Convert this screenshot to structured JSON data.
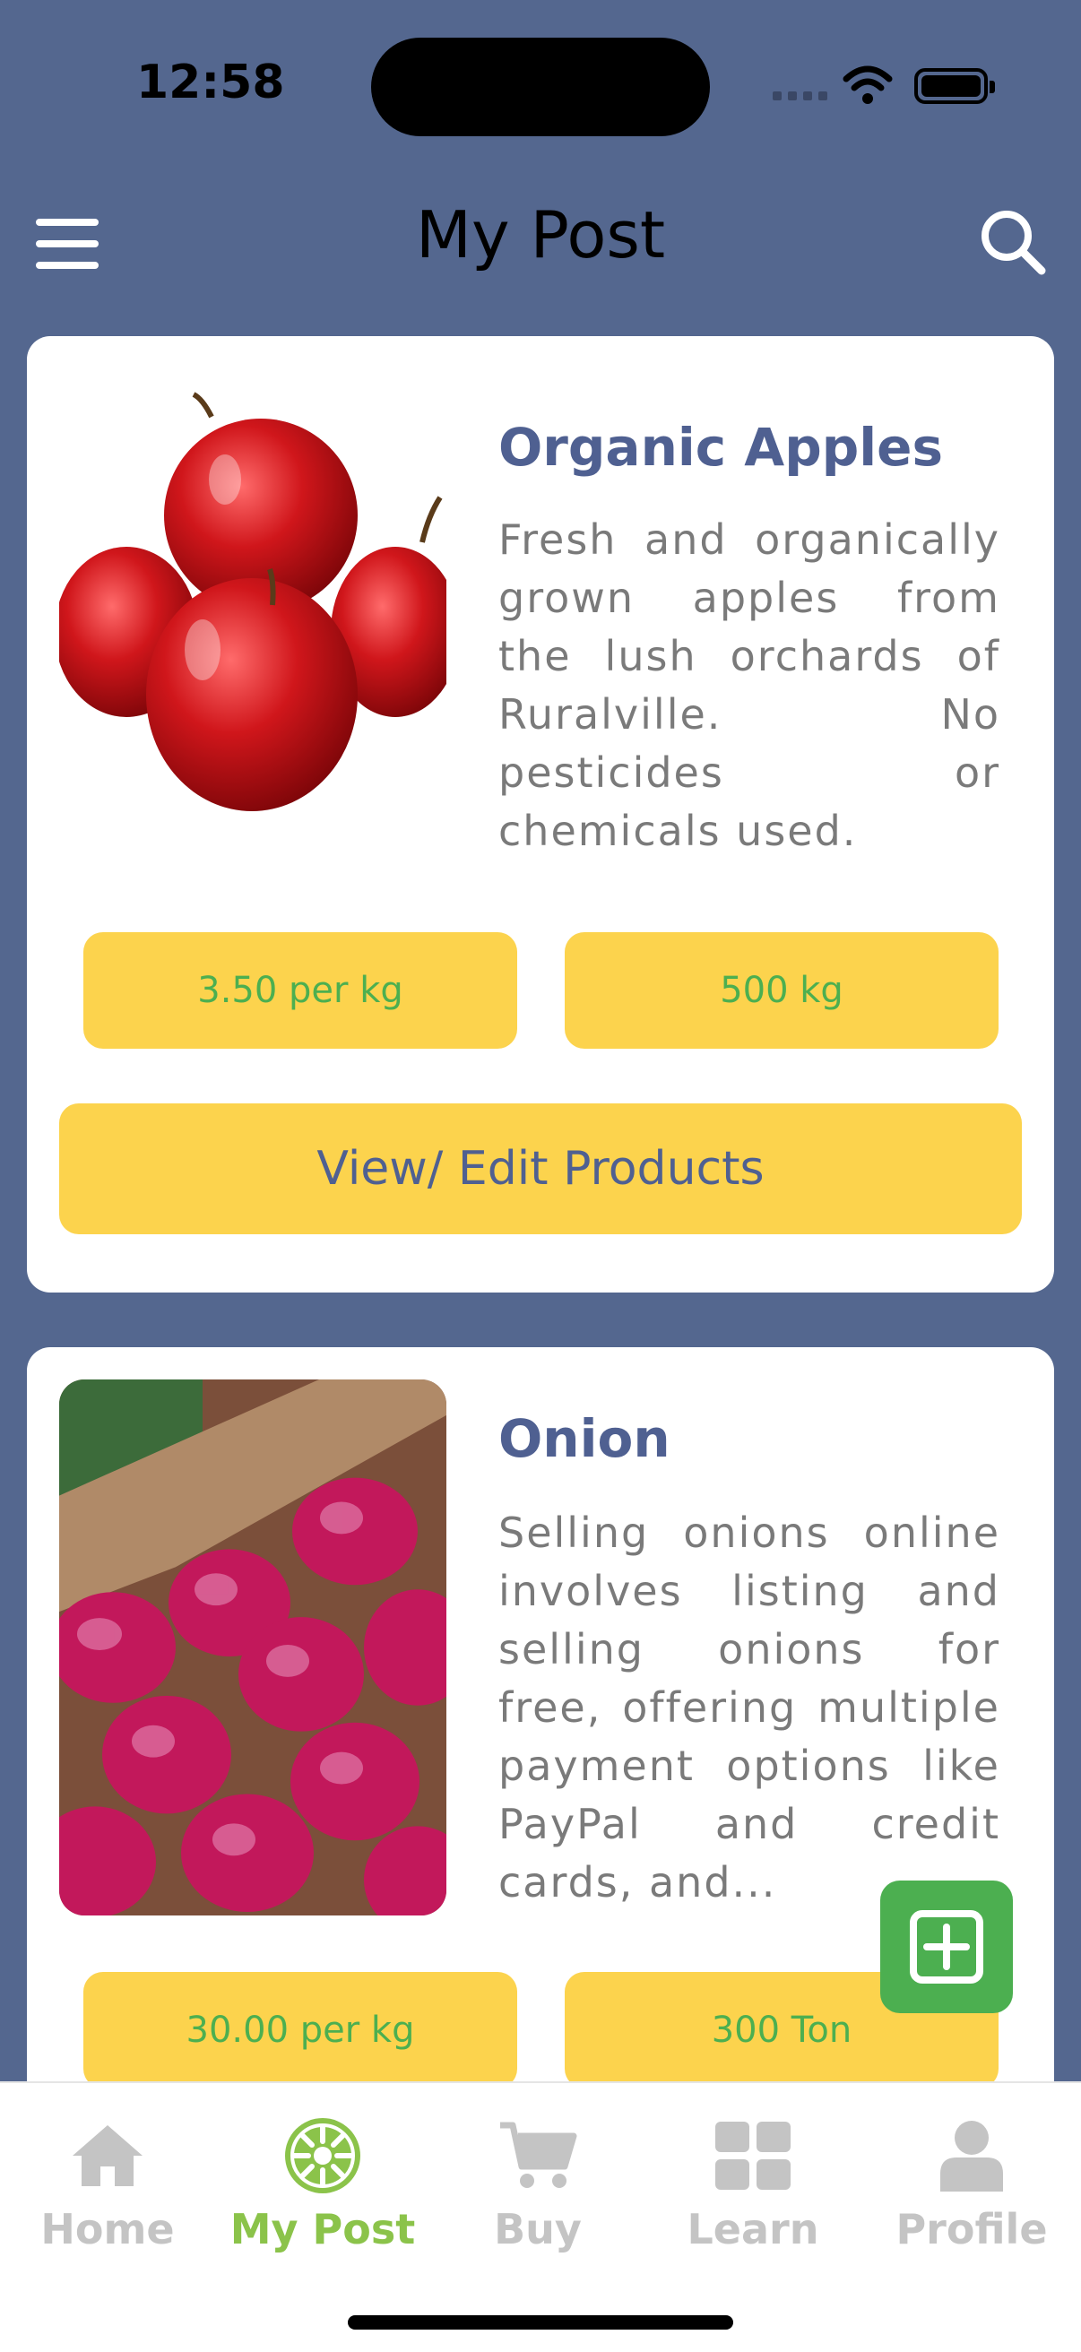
{
  "status_bar": {
    "time": "12:58"
  },
  "header": {
    "title": "My Post"
  },
  "posts": [
    {
      "title": "Organic Apples",
      "description": "Fresh and organically grown apples from the lush orchards of Ruralville. No pesticides or chemicals used.",
      "price": "3.50 per kg",
      "quantity": "500 kg",
      "action_label": "View/ Edit Products"
    },
    {
      "title": "Onion",
      "description": "Selling onions online involves listing and selling onions for free, offering multiple payment options like PayPal and credit cards, and...",
      "price": "30.00 per kg",
      "quantity": "300 Ton"
    }
  ],
  "nav": {
    "items": [
      {
        "label": "Home",
        "icon": "home-icon"
      },
      {
        "label": "My Post",
        "icon": "post-icon",
        "active": true
      },
      {
        "label": "Buy",
        "icon": "cart-icon"
      },
      {
        "label": "Learn",
        "icon": "grid-icon"
      },
      {
        "label": "Profile",
        "icon": "profile-icon"
      }
    ]
  },
  "colors": {
    "background": "#54678f",
    "accent_yellow": "#fcd34d",
    "accent_green": "#4caf50",
    "title_blue": "#4f6091",
    "nav_active": "#8bc34a"
  }
}
